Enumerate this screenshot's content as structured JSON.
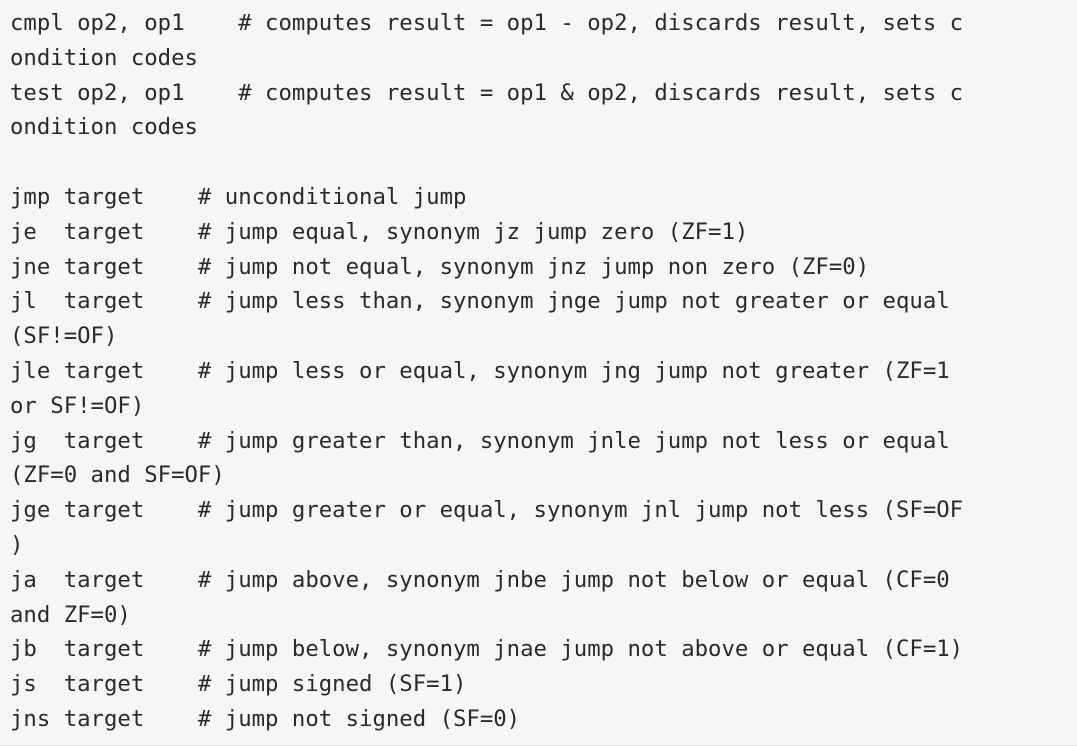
{
  "code": {
    "lines": [
      "cmpl op2, op1    # computes result = op1 - op2, discards result, sets c",
      "ondition codes",
      "test op2, op1    # computes result = op1 & op2, discards result, sets c",
      "ondition codes",
      "",
      "jmp target    # unconditional jump",
      "je  target    # jump equal, synonym jz jump zero (ZF=1)",
      "jne target    # jump not equal, synonym jnz jump non zero (ZF=0)",
      "jl  target    # jump less than, synonym jnge jump not greater or equal",
      "(SF!=OF)",
      "jle target    # jump less or equal, synonym jng jump not greater (ZF=1",
      "or SF!=OF)",
      "jg  target    # jump greater than, synonym jnle jump not less or equal",
      "(ZF=0 and SF=OF)",
      "jge target    # jump greater or equal, synonym jnl jump not less (SF=OF",
      ")",
      "ja  target    # jump above, synonym jnbe jump not below or equal (CF=0",
      "and ZF=0)",
      "jb  target    # jump below, synonym jnae jump not above or equal (CF=1)",
      "js  target    # jump signed (SF=1)",
      "jns target    # jump not signed (SF=0)"
    ]
  }
}
